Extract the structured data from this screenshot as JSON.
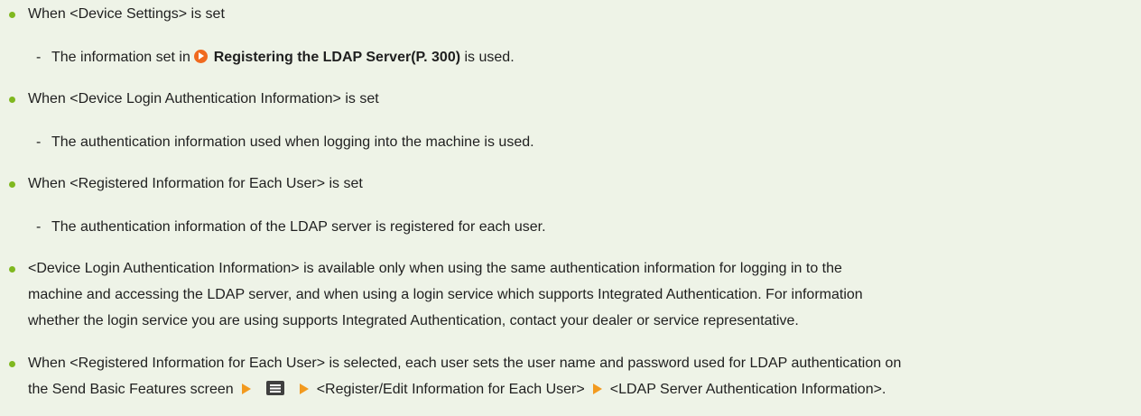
{
  "items": [
    {
      "label": "When <Device Settings> is set",
      "sub": {
        "prefix": "The information set in ",
        "link_text": "Registering the LDAP Server(P. 300)",
        "suffix": " is used."
      }
    },
    {
      "label": "When <Device Login Authentication Information> is set",
      "sub": "The authentication information used when logging into the machine is used."
    },
    {
      "label": "When <Registered Information for Each User> is set",
      "sub": "The authentication information of the LDAP server is registered for each user."
    }
  ],
  "note1": {
    "line1": "<Device Login Authentication Information> is available only when using the same authentication information for logging in to the",
    "line2": "machine and accessing the LDAP server, and when using a login service which supports Integrated Authentication. For information",
    "line3": "whether the login service you are using supports Integrated Authentication, contact your dealer or service representative."
  },
  "note2": {
    "line1": "When <Registered Information for Each User> is selected, each user sets the user name and password used for LDAP authentication on",
    "line2_start": "the Send Basic Features screen",
    "step1": "<Register/Edit Information for Each User>",
    "step2": "<LDAP Server Authentication Information>."
  },
  "colors": {
    "background": "#eef3e7",
    "bullet": "#7fb81f",
    "link_icon": "#f06a1f",
    "arrow": "#f29a1f"
  },
  "icons": {
    "link": "circle-arrow-icon",
    "step": "right-triangle-icon",
    "menu": "menu-icon"
  }
}
